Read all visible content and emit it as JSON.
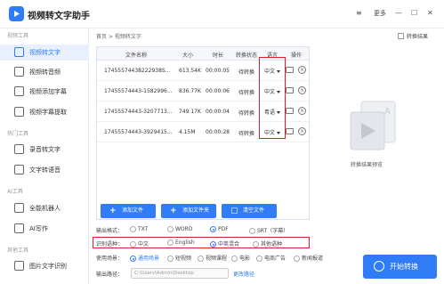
{
  "app": {
    "title": "视频转文字助手",
    "menu_label": "更多"
  },
  "window_controls": {
    "menu": "≡",
    "minimize": "—",
    "maximize": "☐",
    "close": "✕"
  },
  "sidebar": {
    "sections": [
      {
        "label": "视频工具",
        "items": [
          "视频转文字",
          "视频转音频",
          "视频添加字幕",
          "视频字幕提取"
        ]
      },
      {
        "label": "热门工具",
        "items": [
          "录音转文字",
          "文字转语音"
        ]
      },
      {
        "label": "AI工具",
        "items": [
          "全能机器人",
          "AI写作"
        ]
      },
      {
        "label": "其他工具",
        "items": [
          "图片文字识别"
        ]
      }
    ],
    "active": "视频转文字"
  },
  "breadcrumb": "首页 > 视频转文字",
  "preview_toggle_label": "转换结果",
  "table": {
    "headers": [
      "文件名称",
      "大小",
      "时长",
      "转换状态",
      "语言",
      "操作"
    ],
    "rows": [
      {
        "name": "17455574438222938S...",
        "size": "613.54K",
        "duration": "00:00:05",
        "status": "待转换",
        "lang": "中文"
      },
      {
        "name": "17455574443-1582996...",
        "size": "836.77K",
        "duration": "00:00:06",
        "status": "待转换",
        "lang": "中文"
      },
      {
        "name": "17455574443-3207713...",
        "size": "749.17K",
        "duration": "00:00:04",
        "status": "待转换",
        "lang": "粤语"
      },
      {
        "name": "17455574443-3929415...",
        "size": "4.15M",
        "duration": "00:00:28",
        "status": "待转换",
        "lang": "中文"
      }
    ]
  },
  "buttons": {
    "add_file": "添加文件",
    "add_folder": "添加文件夹",
    "clear_files": "清空文件"
  },
  "preview": {
    "label": "转换结果预览"
  },
  "output_format": {
    "label": "输出格式：",
    "options": [
      "TXT",
      "WORD",
      "PDF",
      "SRT（字幕）"
    ],
    "selected": "PDF"
  },
  "recognition_language": {
    "label": "识别语种：",
    "options": [
      "中文",
      "English",
      "中英混合",
      "其他语种"
    ],
    "selected": "中英混合"
  },
  "scene": {
    "label": "使用场景：",
    "options": [
      "通用场景",
      "短视频",
      "视频课程",
      "电影",
      "电商广告",
      "新闻报道"
    ],
    "selected": "通用场景"
  },
  "output_path": {
    "label": "输出路径：",
    "value": "C:\\Users\\Admin\\Desktop",
    "change_label": "更改路径"
  },
  "start_button": "开始转换",
  "colors": {
    "accent": "#2f7cf6",
    "highlight": "#e02020",
    "active_bg": "#e8f0fe"
  }
}
